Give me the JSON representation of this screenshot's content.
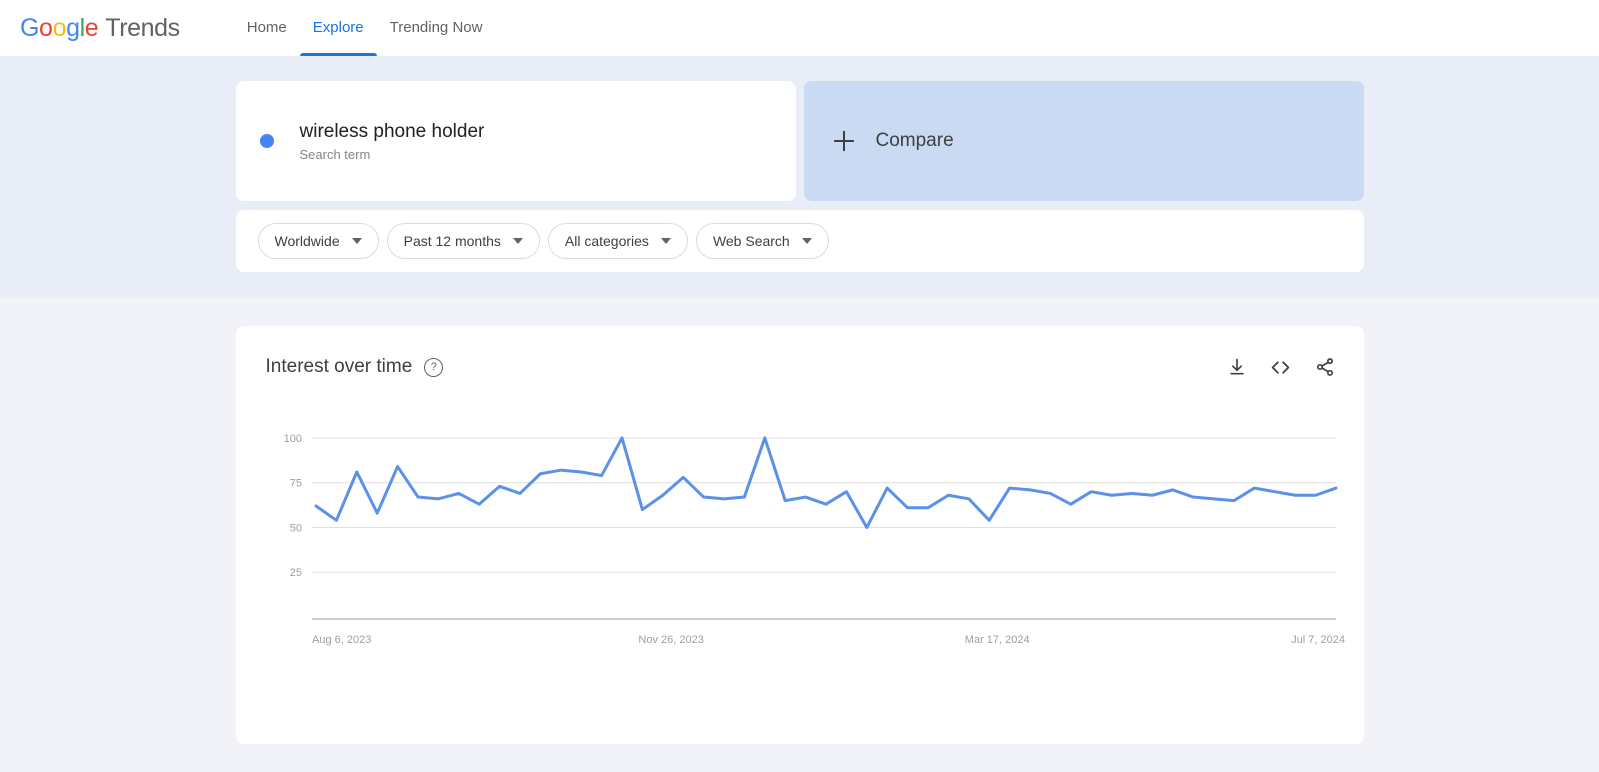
{
  "nav": {
    "logo_parts": [
      "G",
      "o",
      "o",
      "g",
      "l",
      "e"
    ],
    "logo_suffix": "Trends",
    "links": [
      {
        "label": "Home",
        "active": false
      },
      {
        "label": "Explore",
        "active": true
      },
      {
        "label": "Trending Now",
        "active": false
      }
    ]
  },
  "query": {
    "term": {
      "title": "wireless phone holder",
      "subtitle": "Search term",
      "dot_color": "#4285F4"
    },
    "compare": {
      "label": "Compare",
      "icon": "plus-icon"
    },
    "filters": [
      {
        "label": "Worldwide",
        "name": "location"
      },
      {
        "label": "Past 12 months",
        "name": "time-range"
      },
      {
        "label": "All categories",
        "name": "category"
      },
      {
        "label": "Web Search",
        "name": "search-type"
      }
    ]
  },
  "chart_card": {
    "title": "Interest over time",
    "help_glyph": "?",
    "actions": [
      {
        "name": "download-icon",
        "label": "Download"
      },
      {
        "name": "embed-code-icon",
        "label": "Embed"
      },
      {
        "name": "share-icon",
        "label": "Share"
      }
    ]
  },
  "chart_data": {
    "type": "line",
    "title": "Interest over time",
    "xlabel": "",
    "ylabel": "",
    "ylim": [
      0,
      105
    ],
    "yticks": [
      25,
      50,
      75,
      100
    ],
    "grid": true,
    "legend": false,
    "line_color": "#5a91ea",
    "x_tick_labels": [
      "Aug 6, 2023",
      "Nov 26, 2023",
      "Mar 17, 2024",
      "Jul 7, 2024"
    ],
    "x_tick_indices": [
      0,
      16,
      32,
      48
    ],
    "series": [
      {
        "name": "wireless phone holder",
        "values": [
          62,
          54,
          81,
          58,
          84,
          67,
          66,
          69,
          63,
          73,
          69,
          80,
          82,
          81,
          79,
          100,
          60,
          68,
          78,
          67,
          66,
          67,
          100,
          65,
          67,
          63,
          70,
          50,
          72,
          61,
          61,
          68,
          66,
          54,
          72,
          71,
          69,
          63,
          70,
          68,
          69,
          68,
          71,
          67,
          66,
          65,
          72,
          70,
          68,
          68,
          72
        ]
      }
    ]
  }
}
